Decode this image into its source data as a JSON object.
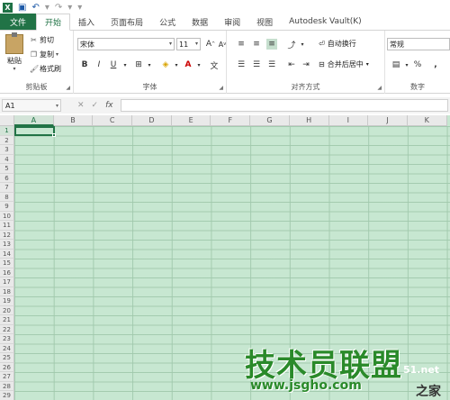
{
  "qat": {
    "logo": "X",
    "save_icon": "save-icon",
    "undo_icon": "undo-icon",
    "redo_icon": "redo-icon"
  },
  "tabs": [
    "文件",
    "开始",
    "插入",
    "页面布局",
    "公式",
    "数据",
    "审阅",
    "视图",
    "Autodesk Vault(K)"
  ],
  "active_tab": "开始",
  "clipboard": {
    "paste": "粘贴",
    "cut": "剪切",
    "copy": "复制",
    "format_painter": "格式刷",
    "label": "剪贴板"
  },
  "font": {
    "name": "宋体",
    "size": "11",
    "label": "字体",
    "grow": "A",
    "shrink": "A",
    "bold": "B",
    "italic": "I",
    "underline": "U"
  },
  "alignment": {
    "wrap": "自动换行",
    "merge": "合并后居中",
    "label": "对齐方式"
  },
  "number": {
    "format": "常规",
    "percent": "%",
    "comma": ",",
    "label": "数字"
  },
  "formula_bar": {
    "name_box": "A1",
    "fx": "fx",
    "cancel": "✕",
    "enter": "✓"
  },
  "grid": {
    "columns": [
      "A",
      "B",
      "C",
      "D",
      "E",
      "F",
      "G",
      "H",
      "I",
      "J",
      "K"
    ],
    "rows": [
      "1",
      "2",
      "3",
      "4",
      "5",
      "6",
      "7",
      "8",
      "9",
      "10",
      "11",
      "12",
      "13",
      "14",
      "15",
      "16",
      "17",
      "18",
      "19",
      "20",
      "21",
      "22",
      "23",
      "24",
      "25",
      "26",
      "27",
      "28",
      "29"
    ],
    "selected_cell": "A1"
  },
  "watermark": {
    "text": "技术员联盟",
    "url": "www.jsgho.com",
    "side": "51.net",
    "side2": "之家"
  },
  "colors": {
    "accent": "#217346",
    "grid_bg": "#c7e7d1",
    "watermark": "#2a8a2a"
  }
}
